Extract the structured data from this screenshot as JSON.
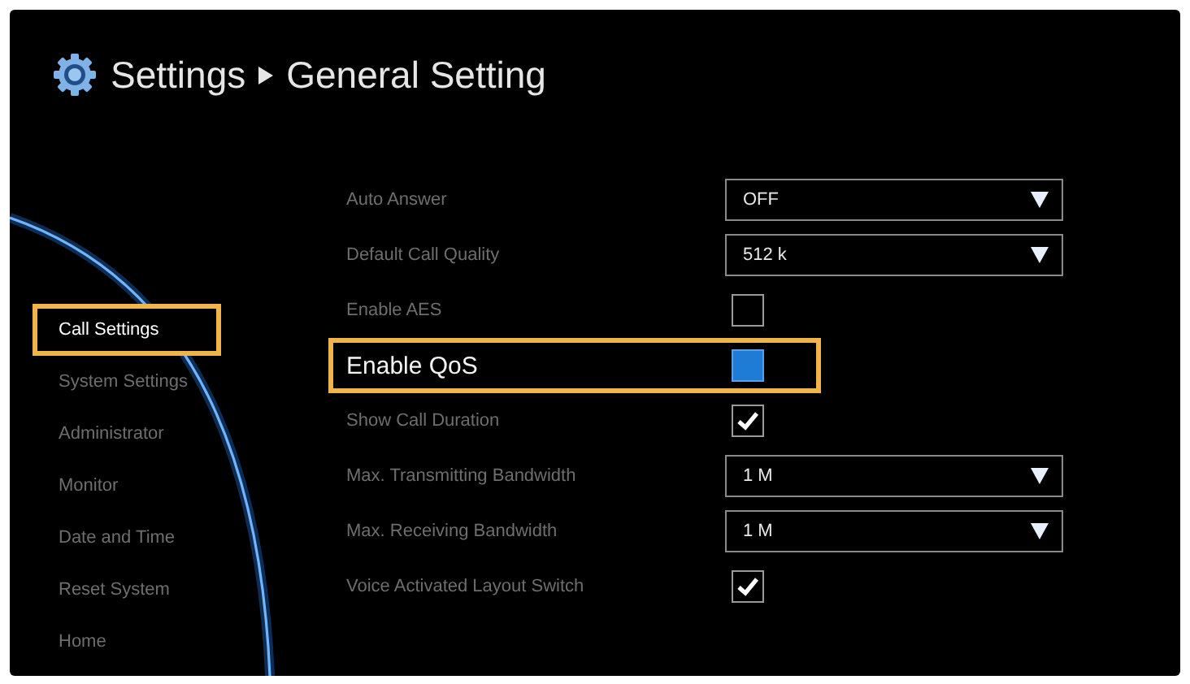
{
  "header": {
    "breadcrumb": [
      "Settings",
      "General Setting"
    ]
  },
  "sidebar": {
    "items": [
      {
        "label": "Call Settings",
        "selected": true
      },
      {
        "label": "System Settings",
        "selected": false
      },
      {
        "label": "Administrator",
        "selected": false
      },
      {
        "label": "Monitor",
        "selected": false
      },
      {
        "label": "Date and Time",
        "selected": false
      },
      {
        "label": "Reset System",
        "selected": false
      },
      {
        "label": "Home",
        "selected": false
      }
    ]
  },
  "settings": [
    {
      "kind": "dropdown",
      "label": "Auto Answer",
      "value": "OFF",
      "focused": false
    },
    {
      "kind": "dropdown",
      "label": "Default Call Quality",
      "value": "512 k",
      "focused": false
    },
    {
      "kind": "checkbox",
      "label": "Enable AES",
      "checked": false,
      "focused": false
    },
    {
      "kind": "checkbox",
      "label": "Enable QoS",
      "checked": false,
      "focused": true
    },
    {
      "kind": "checkbox",
      "label": "Show Call Duration",
      "checked": true,
      "focused": false
    },
    {
      "kind": "dropdown",
      "label": "Max. Transmitting Bandwidth",
      "value": "1 M",
      "focused": false
    },
    {
      "kind": "dropdown",
      "label": "Max. Receiving Bandwidth",
      "value": "1 M",
      "focused": false
    },
    {
      "kind": "checkbox",
      "label": "Voice Activated Layout Switch",
      "checked": true,
      "focused": false
    }
  ]
}
